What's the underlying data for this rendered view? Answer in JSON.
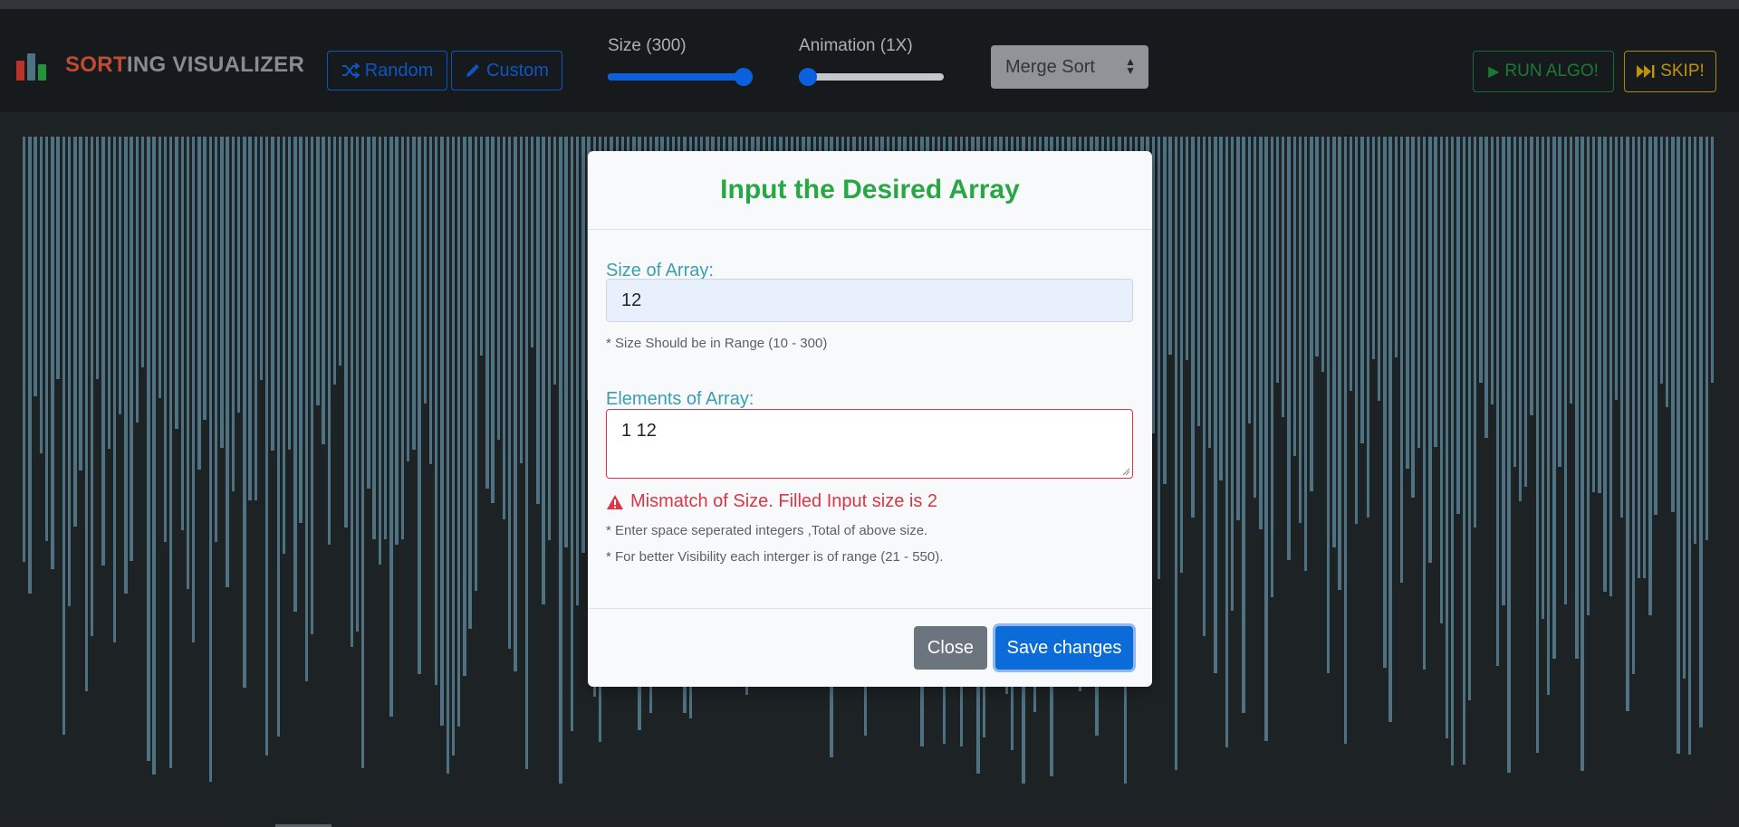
{
  "navbar": {
    "brand_highlight": "SORT",
    "brand_rest": "ING VISUALIZER",
    "random_label": "Random",
    "custom_label": "Custom",
    "size_label": "Size (300)",
    "size_value": 300,
    "size_range": [
      10,
      300
    ],
    "animation_label": "Animation (1X)",
    "animation_level": 0,
    "algorithm_selected": "Merge Sort",
    "run_label": "RUN ALGO!",
    "skip_label": "SKIP!"
  },
  "colors": {
    "accent": "#0d6efd",
    "bar": "#5a8294",
    "success": "#28a745",
    "danger": "#dc3545",
    "warning": "#d9a70d"
  },
  "modal": {
    "title": "Input the Desired Array",
    "size_label": "Size of Array:",
    "size_value": "12",
    "size_hint": "* Size Should be in Range (10 - 300)",
    "elements_label": "Elements of Array:",
    "elements_value": "1 12",
    "error_message": "Mismatch of Size. Filled Input size is 2",
    "hint_1": "* Enter space seperated integers ,Total of above size.",
    "hint_2": "* For better Visibility each interger is of range (21 - 550).",
    "close_label": "Close",
    "save_label": "Save changes"
  },
  "icons": {
    "random": "shuffle-icon",
    "custom": "pencil-icon",
    "run": "play-icon",
    "skip": "fast-forward-icon",
    "error": "warning-triangle-icon"
  }
}
